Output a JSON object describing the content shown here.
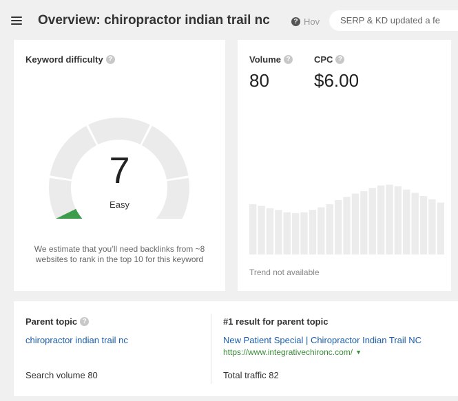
{
  "header": {
    "title": "Overview: chiropractor indian trail nc",
    "how_link": "Hov",
    "serp_status": "SERP & KD updated a fe"
  },
  "keyword_difficulty": {
    "label": "Keyword difficulty",
    "value": "7",
    "rating": "Easy",
    "note": "We estimate that you’ll need backlinks from ~8 websites to rank in the top 10 for this keyword",
    "gauge_fraction": 0.07,
    "colors": {
      "active": "#3d9b4c",
      "track": "#ebebeb"
    }
  },
  "volume": {
    "label": "Volume",
    "value": "80"
  },
  "cpc": {
    "label": "CPC",
    "value": "$6.00"
  },
  "trend": {
    "note": "Trend not available",
    "bars": [
      0.62,
      0.6,
      0.57,
      0.55,
      0.52,
      0.51,
      0.52,
      0.55,
      0.58,
      0.62,
      0.67,
      0.71,
      0.75,
      0.78,
      0.82,
      0.85,
      0.86,
      0.84,
      0.8,
      0.76,
      0.72,
      0.68,
      0.64
    ],
    "bar_color": "#ececec"
  },
  "parent_topic": {
    "label": "Parent topic",
    "link": "chiropractor indian trail nc",
    "search_volume": "Search volume 80"
  },
  "top_result": {
    "label": "#1 result for parent topic",
    "title": "New Patient Special | Chiropractor Indian Trail NC",
    "url": "https://www.integrativechironc.com/",
    "traffic": "Total traffic 82"
  }
}
